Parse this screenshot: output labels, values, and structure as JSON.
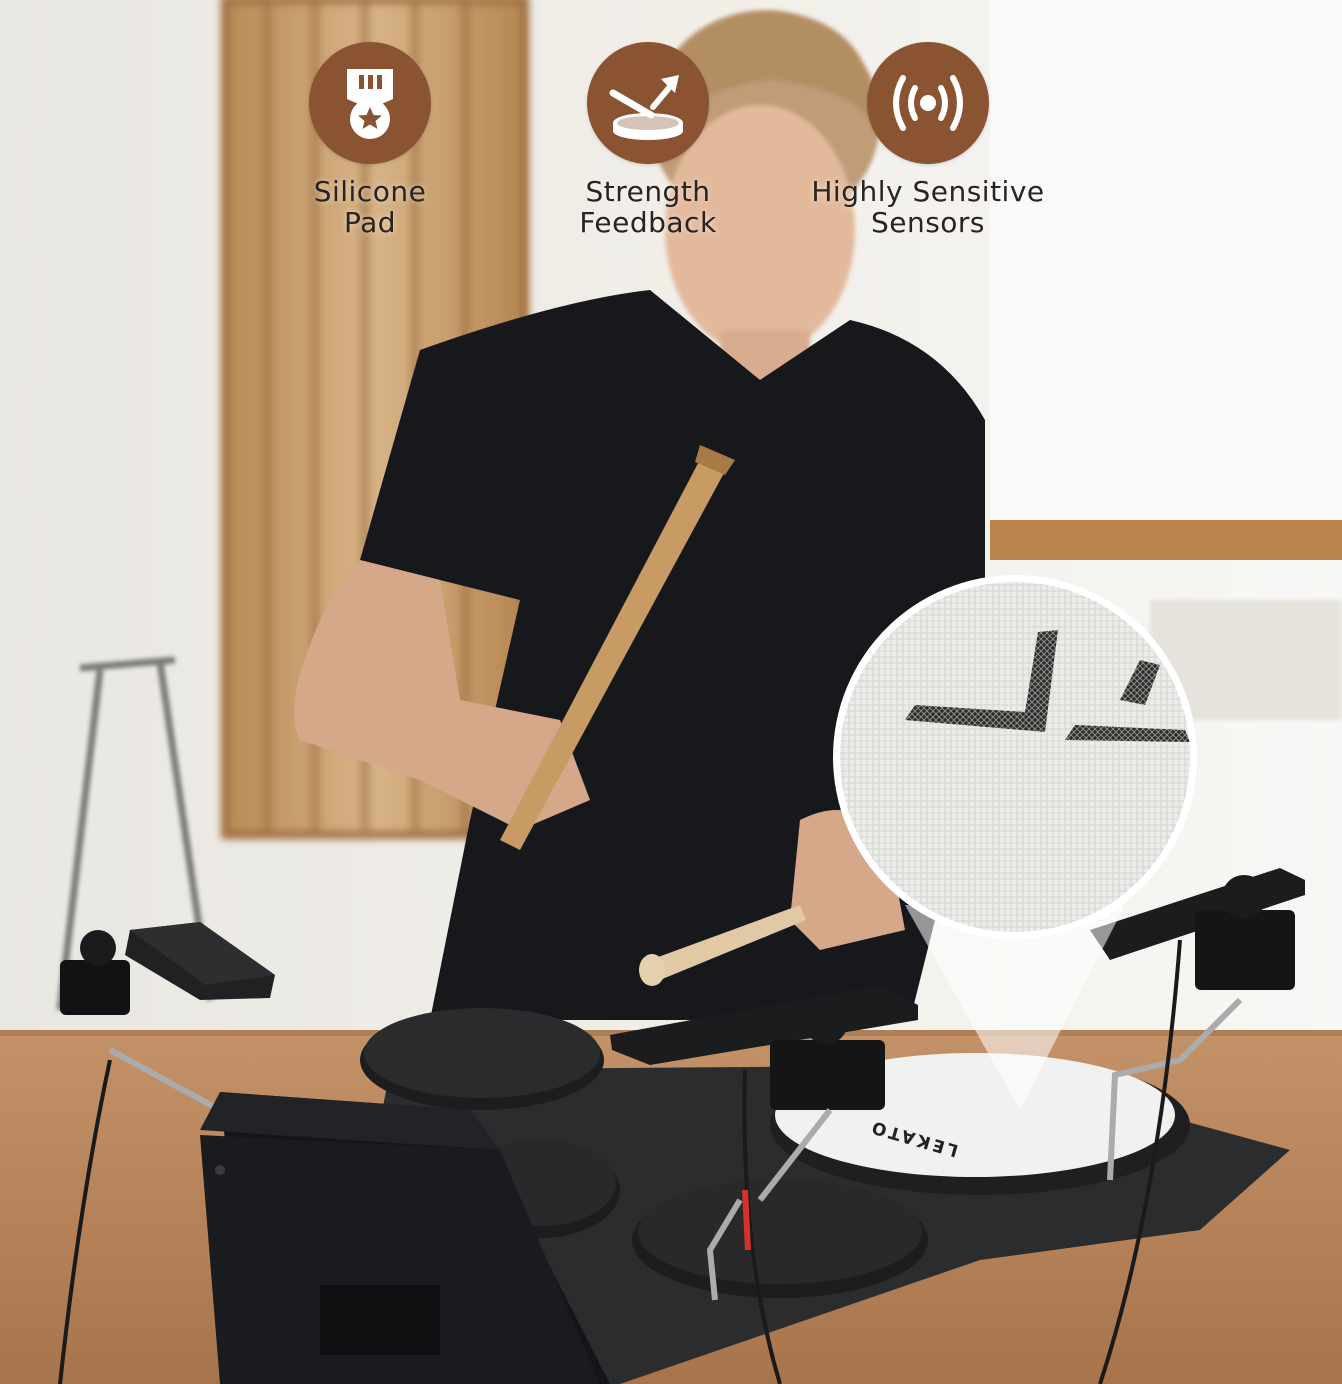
{
  "accent_color": "#8a5433",
  "features": [
    {
      "icon": "silicone-pad-medal-icon",
      "line1": "Silicone",
      "line2": "Pad"
    },
    {
      "icon": "drum-strike-arrow-icon",
      "line1": "Strength",
      "line2": "Feedback"
    },
    {
      "icon": "sensor-waves-icon",
      "line1": "Highly Sensitive",
      "line2": "Sensors"
    }
  ],
  "zoom_detail_letters": "LE",
  "pad_brand": "LEKATO"
}
